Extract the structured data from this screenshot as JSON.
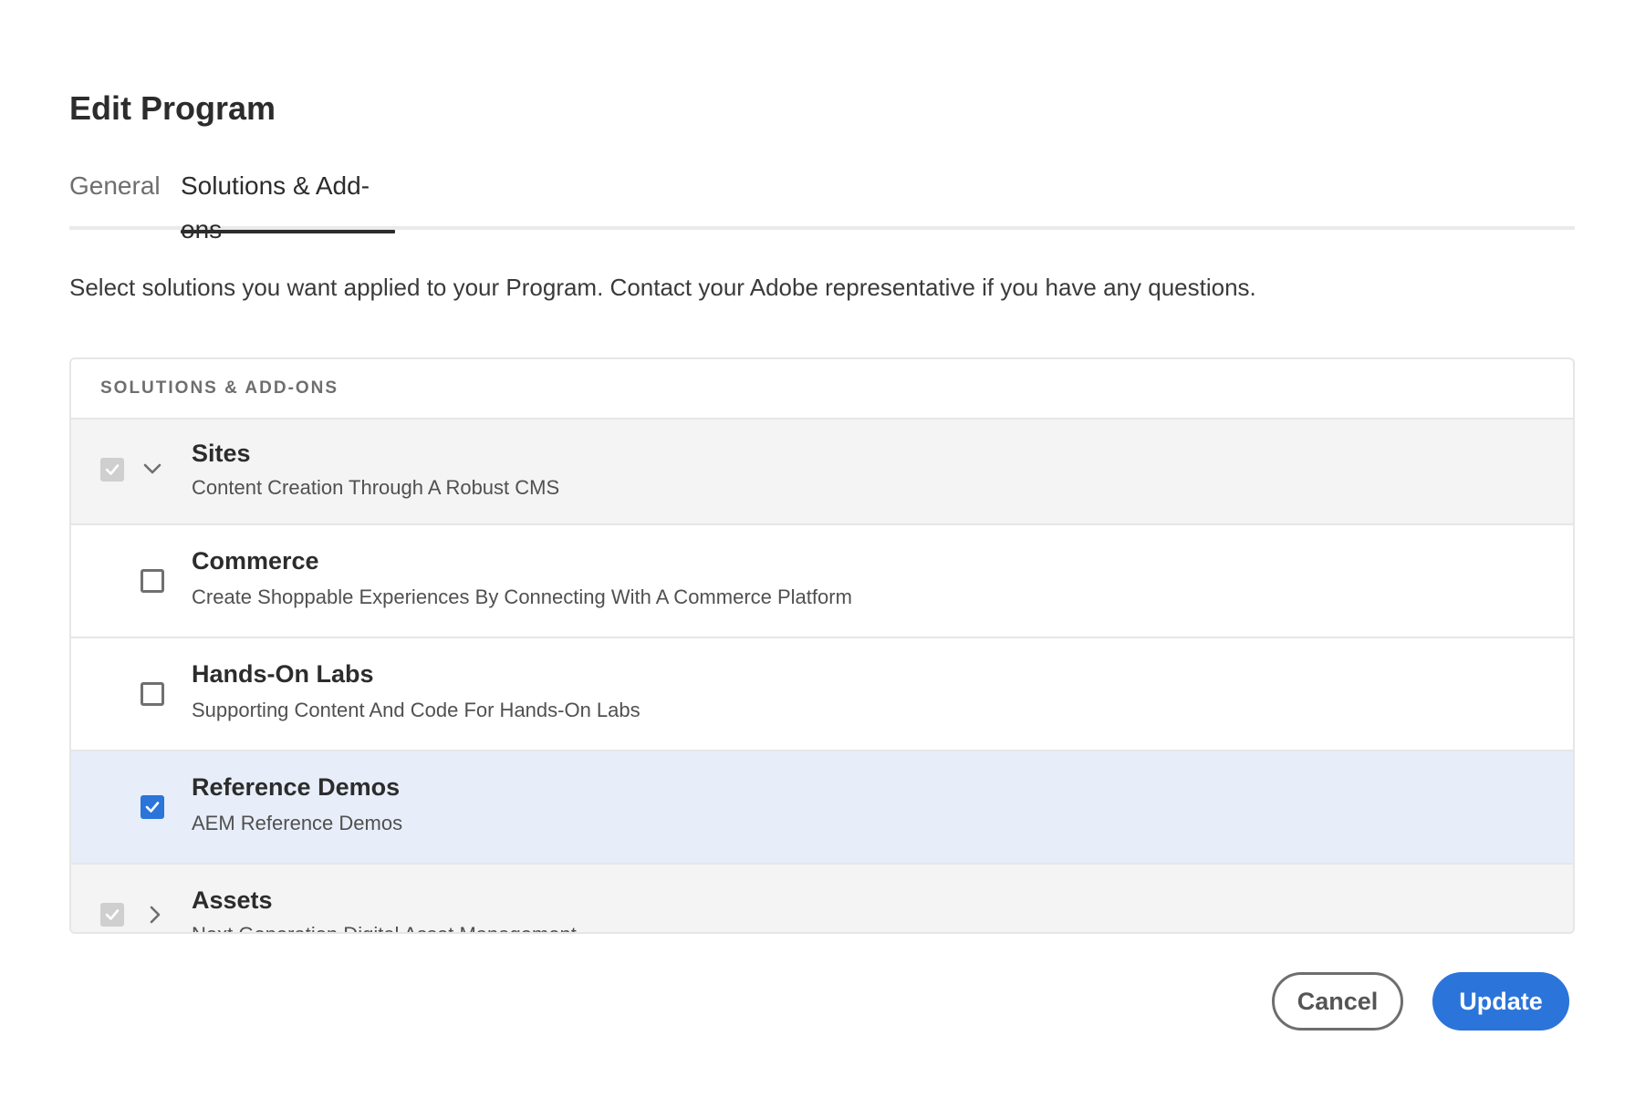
{
  "dialog": {
    "title": "Edit Program",
    "tabs": [
      {
        "label": "General"
      },
      {
        "label": "Solutions & Add-ons"
      }
    ],
    "description": "Select solutions you want applied to your Program. Contact your Adobe representative if you have any questions."
  },
  "table": {
    "header": "SOLUTIONS & ADD-ONS",
    "rows": [
      {
        "name": "Sites",
        "subtitle": "Content Creation Through A Robust CMS",
        "checked": true,
        "disabled": true,
        "expanded": true,
        "icon": "chevron-down-icon"
      },
      {
        "name": "Commerce",
        "subtitle": "Create Shoppable Experiences By Connecting With A Commerce Platform",
        "checked": false
      },
      {
        "name": "Hands-On Labs",
        "subtitle": "Supporting Content And Code For Hands-On Labs",
        "checked": false
      },
      {
        "name": "Reference Demos",
        "subtitle": "AEM Reference Demos",
        "checked": true
      },
      {
        "name": "Assets",
        "subtitle": "Next Generation Digital Asset Management",
        "checked": true,
        "disabled": true,
        "expanded": false,
        "icon": "chevron-right-icon"
      }
    ]
  },
  "footer": {
    "cancel_label": "Cancel",
    "update_label": "Update"
  },
  "colors": {
    "accent": "#2b74da",
    "selected_row": "#e7eef9",
    "parent_row": "#f4f4f4"
  }
}
